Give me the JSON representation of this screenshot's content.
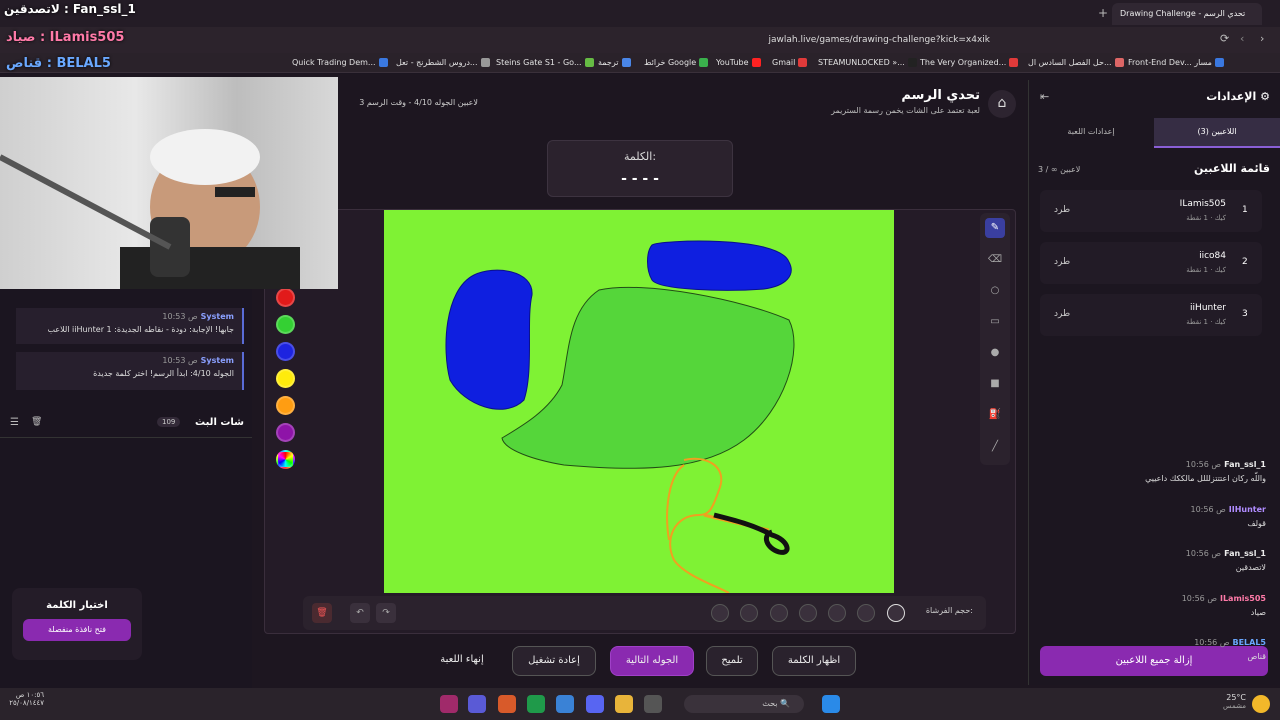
{
  "browser": {
    "tab_title": "Drawing Challenge - تحدي الرسم",
    "url": "jawlah.live/games/drawing-challenge?kick=x4xik",
    "bookmarks": [
      "Front-End Dev... مسار",
      "حل الفصل السادس ال...",
      "The Very Organized...",
      "STEAMUNLOCKED »...",
      "Gmail",
      "YouTube",
      "خرائط Google",
      "ترجمة",
      "Steins Gate S1 - Go...",
      "دروس الشطرنج - تعل...",
      "Quick Trading Dem..."
    ]
  },
  "overlay": {
    "line1": "لاتصدقين : Fan_ssl_1",
    "line2": "صياد : ILamis505",
    "line3": "قناص : BELAL5"
  },
  "header": {
    "title": "تحدي الرسم",
    "subtitle": "لعبة تعتمد على الشات يخمن رسمة الستريمر",
    "status": "3 لاعبين  الجوله 4/10 - وقت الرسم"
  },
  "word": {
    "label": "الكلمة:",
    "mask": "- - - -"
  },
  "colors": [
    "#e11a1a",
    "#34d033",
    "#1d24e0",
    "#ffeb0c",
    "#ff9d12",
    "#8e14a8"
  ],
  "system_msgs": [
    {
      "name": "System",
      "time": "10:53 ص",
      "text": "اللاعب iiHunter جابها! الإجابة: دودة - نقاطه الجديدة: 1"
    },
    {
      "name": "System",
      "time": "10:53 ص",
      "text": "الجوله 4/10: ابدأ الرسم! اختر كلمة جديدة"
    }
  ],
  "chat": {
    "title": "شات البث",
    "count": "109",
    "msgs": [
      {
        "name": "Fan_ssl_1",
        "time": "10:56 ص",
        "text": "واللّه ركان اعتتتزلللل مالككك داعييي"
      },
      {
        "name": "IIHunter",
        "time": "10:56 ص",
        "text": "قولف"
      },
      {
        "name": "Fan_ssl_1",
        "time": "10:56 ص",
        "text": "لاتصدقين"
      },
      {
        "name": "ILamis505",
        "time": "10:56 ص",
        "text": "صياد"
      },
      {
        "name": "BELAL5",
        "time": "10:56 ص",
        "text": "قناص"
      }
    ]
  },
  "choose_word": {
    "title": "اختيار الكلمة",
    "button": "فتح نافذة منفصلة"
  },
  "brush": {
    "label": "حجم الفرشاة:"
  },
  "actions": {
    "end": "إنهاء اللعبة",
    "restart": "إعادة تشغيل",
    "next": "الجوله التالية",
    "hint": "تلميح",
    "show": "اظهار الكلمة"
  },
  "settings": {
    "title": "الإعدادات",
    "tab_players": "اللاعبين (3)",
    "tab_game": "إعدادات اللعبة",
    "list_title": "قائمة اللاعبين",
    "count": "3 / ∞ لاعبين",
    "kick": "طرد",
    "remove_all": "إزالة جميع اللاعبين",
    "players": [
      {
        "rank": "1",
        "name": "ILamis505",
        "sub": "كيك · 1 نقطة"
      },
      {
        "rank": "2",
        "name": "iico84",
        "sub": "كيك · 1 نقطة"
      },
      {
        "rank": "3",
        "name": "iiHunter",
        "sub": "كيك · 1 نقطة"
      }
    ]
  },
  "taskbar": {
    "search": "بحث",
    "temp": "25°C",
    "weather": "مشمس",
    "time": "١٠:٥٦ ص",
    "date": "٢٥/٠٨/١٤٤٧"
  }
}
